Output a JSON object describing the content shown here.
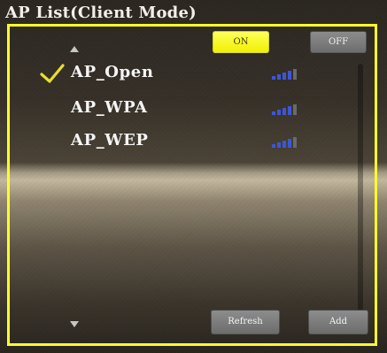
{
  "header": {
    "title": "AP List(Client Mode)"
  },
  "mode_toggle": {
    "on_label": "ON",
    "off_label": "OFF",
    "selected": "ON"
  },
  "ap_list": {
    "items": [
      {
        "name": "AP_Open",
        "connected": true,
        "signal_bars": 4,
        "signal_max": 5
      },
      {
        "name": "AP_WPA",
        "connected": false,
        "signal_bars": 4,
        "signal_max": 5
      },
      {
        "name": "AP_WEP",
        "connected": false,
        "signal_bars": 4,
        "signal_max": 5
      }
    ]
  },
  "footer": {
    "refresh_label": "Refresh",
    "add_label": "Add"
  },
  "colors": {
    "accent_yellow": "#ffff2a",
    "signal_blue": "#3d56d6",
    "button_gray": "#7a7a7a",
    "check_yellow": "#e8df2a"
  },
  "icons": {
    "connected_indicator": "checkmark-icon",
    "scroll_up": "triangle-up-icon",
    "scroll_down": "triangle-down-icon",
    "signal": "signal-strength-icon"
  }
}
